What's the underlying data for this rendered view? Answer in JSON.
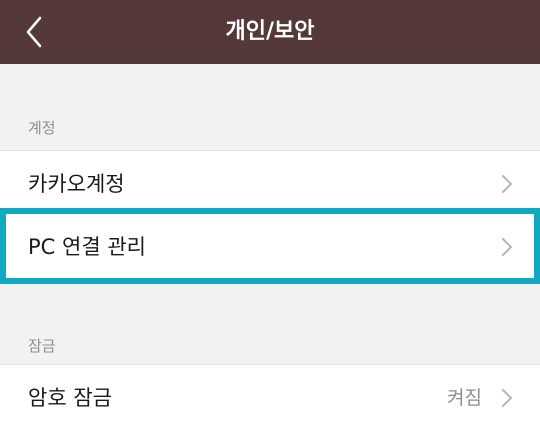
{
  "header": {
    "title": "개인/보안",
    "back_icon": "chevron-left-icon"
  },
  "sections": {
    "account": {
      "label": "계정",
      "items": [
        {
          "label": "카카오계정",
          "icon": "chevron-right-icon"
        },
        {
          "label": "PC 연결 관리",
          "icon": "chevron-right-icon"
        }
      ]
    },
    "lock": {
      "label": "잠금",
      "items": [
        {
          "label": "암호 잠금",
          "value": "켜짐",
          "icon": "chevron-right-icon"
        }
      ]
    }
  },
  "colors": {
    "header_bg": "#553838",
    "highlight": "#10a9c2"
  }
}
